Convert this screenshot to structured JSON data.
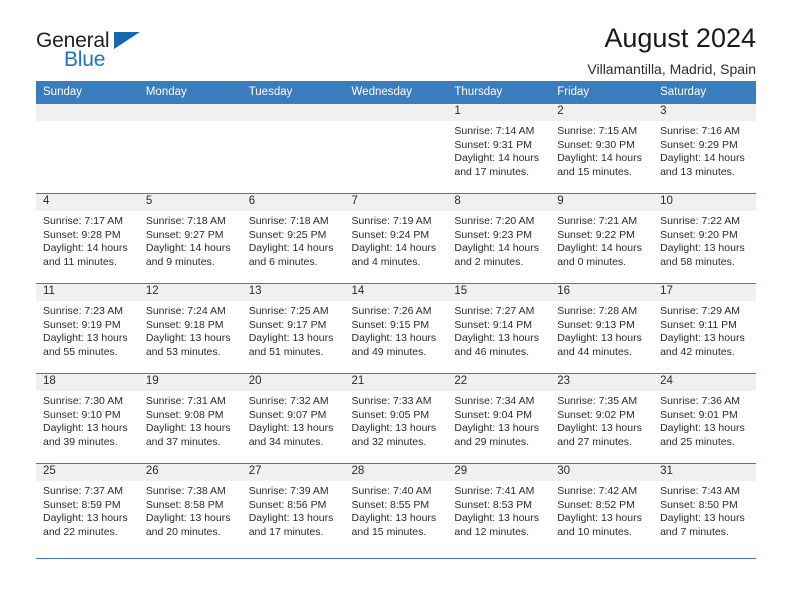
{
  "brand": {
    "name_part1": "General",
    "name_part2": "Blue",
    "flag_icon": "triangle-flag-icon"
  },
  "header": {
    "title": "August 2024",
    "subtitle": "Villamantilla, Madrid, Spain"
  },
  "colors": {
    "header_blue": "#3a7cbe",
    "brand_blue": "#1b76bc",
    "daynum_band": "#f0f0f0",
    "text": "#2b2b2b"
  },
  "weekdays": [
    "Sunday",
    "Monday",
    "Tuesday",
    "Wednesday",
    "Thursday",
    "Friday",
    "Saturday"
  ],
  "labels": {
    "sunrise_prefix": "Sunrise:",
    "sunset_prefix": "Sunset:",
    "daylight_prefix": "Daylight:"
  },
  "weeks": [
    [
      {
        "day": "",
        "lines": []
      },
      {
        "day": "",
        "lines": []
      },
      {
        "day": "",
        "lines": []
      },
      {
        "day": "",
        "lines": []
      },
      {
        "day": "1",
        "lines": [
          "Sunrise: 7:14 AM",
          "Sunset: 9:31 PM",
          "Daylight: 14 hours",
          "and 17 minutes."
        ]
      },
      {
        "day": "2",
        "lines": [
          "Sunrise: 7:15 AM",
          "Sunset: 9:30 PM",
          "Daylight: 14 hours",
          "and 15 minutes."
        ]
      },
      {
        "day": "3",
        "lines": [
          "Sunrise: 7:16 AM",
          "Sunset: 9:29 PM",
          "Daylight: 14 hours",
          "and 13 minutes."
        ]
      }
    ],
    [
      {
        "day": "4",
        "lines": [
          "Sunrise: 7:17 AM",
          "Sunset: 9:28 PM",
          "Daylight: 14 hours",
          "and 11 minutes."
        ]
      },
      {
        "day": "5",
        "lines": [
          "Sunrise: 7:18 AM",
          "Sunset: 9:27 PM",
          "Daylight: 14 hours",
          "and 9 minutes."
        ]
      },
      {
        "day": "6",
        "lines": [
          "Sunrise: 7:18 AM",
          "Sunset: 9:25 PM",
          "Daylight: 14 hours",
          "and 6 minutes."
        ]
      },
      {
        "day": "7",
        "lines": [
          "Sunrise: 7:19 AM",
          "Sunset: 9:24 PM",
          "Daylight: 14 hours",
          "and 4 minutes."
        ]
      },
      {
        "day": "8",
        "lines": [
          "Sunrise: 7:20 AM",
          "Sunset: 9:23 PM",
          "Daylight: 14 hours",
          "and 2 minutes."
        ]
      },
      {
        "day": "9",
        "lines": [
          "Sunrise: 7:21 AM",
          "Sunset: 9:22 PM",
          "Daylight: 14 hours",
          "and 0 minutes."
        ]
      },
      {
        "day": "10",
        "lines": [
          "Sunrise: 7:22 AM",
          "Sunset: 9:20 PM",
          "Daylight: 13 hours",
          "and 58 minutes."
        ]
      }
    ],
    [
      {
        "day": "11",
        "lines": [
          "Sunrise: 7:23 AM",
          "Sunset: 9:19 PM",
          "Daylight: 13 hours",
          "and 55 minutes."
        ]
      },
      {
        "day": "12",
        "lines": [
          "Sunrise: 7:24 AM",
          "Sunset: 9:18 PM",
          "Daylight: 13 hours",
          "and 53 minutes."
        ]
      },
      {
        "day": "13",
        "lines": [
          "Sunrise: 7:25 AM",
          "Sunset: 9:17 PM",
          "Daylight: 13 hours",
          "and 51 minutes."
        ]
      },
      {
        "day": "14",
        "lines": [
          "Sunrise: 7:26 AM",
          "Sunset: 9:15 PM",
          "Daylight: 13 hours",
          "and 49 minutes."
        ]
      },
      {
        "day": "15",
        "lines": [
          "Sunrise: 7:27 AM",
          "Sunset: 9:14 PM",
          "Daylight: 13 hours",
          "and 46 minutes."
        ]
      },
      {
        "day": "16",
        "lines": [
          "Sunrise: 7:28 AM",
          "Sunset: 9:13 PM",
          "Daylight: 13 hours",
          "and 44 minutes."
        ]
      },
      {
        "day": "17",
        "lines": [
          "Sunrise: 7:29 AM",
          "Sunset: 9:11 PM",
          "Daylight: 13 hours",
          "and 42 minutes."
        ]
      }
    ],
    [
      {
        "day": "18",
        "lines": [
          "Sunrise: 7:30 AM",
          "Sunset: 9:10 PM",
          "Daylight: 13 hours",
          "and 39 minutes."
        ]
      },
      {
        "day": "19",
        "lines": [
          "Sunrise: 7:31 AM",
          "Sunset: 9:08 PM",
          "Daylight: 13 hours",
          "and 37 minutes."
        ]
      },
      {
        "day": "20",
        "lines": [
          "Sunrise: 7:32 AM",
          "Sunset: 9:07 PM",
          "Daylight: 13 hours",
          "and 34 minutes."
        ]
      },
      {
        "day": "21",
        "lines": [
          "Sunrise: 7:33 AM",
          "Sunset: 9:05 PM",
          "Daylight: 13 hours",
          "and 32 minutes."
        ]
      },
      {
        "day": "22",
        "lines": [
          "Sunrise: 7:34 AM",
          "Sunset: 9:04 PM",
          "Daylight: 13 hours",
          "and 29 minutes."
        ]
      },
      {
        "day": "23",
        "lines": [
          "Sunrise: 7:35 AM",
          "Sunset: 9:02 PM",
          "Daylight: 13 hours",
          "and 27 minutes."
        ]
      },
      {
        "day": "24",
        "lines": [
          "Sunrise: 7:36 AM",
          "Sunset: 9:01 PM",
          "Daylight: 13 hours",
          "and 25 minutes."
        ]
      }
    ],
    [
      {
        "day": "25",
        "lines": [
          "Sunrise: 7:37 AM",
          "Sunset: 8:59 PM",
          "Daylight: 13 hours",
          "and 22 minutes."
        ]
      },
      {
        "day": "26",
        "lines": [
          "Sunrise: 7:38 AM",
          "Sunset: 8:58 PM",
          "Daylight: 13 hours",
          "and 20 minutes."
        ]
      },
      {
        "day": "27",
        "lines": [
          "Sunrise: 7:39 AM",
          "Sunset: 8:56 PM",
          "Daylight: 13 hours",
          "and 17 minutes."
        ]
      },
      {
        "day": "28",
        "lines": [
          "Sunrise: 7:40 AM",
          "Sunset: 8:55 PM",
          "Daylight: 13 hours",
          "and 15 minutes."
        ]
      },
      {
        "day": "29",
        "lines": [
          "Sunrise: 7:41 AM",
          "Sunset: 8:53 PM",
          "Daylight: 13 hours",
          "and 12 minutes."
        ]
      },
      {
        "day": "30",
        "lines": [
          "Sunrise: 7:42 AM",
          "Sunset: 8:52 PM",
          "Daylight: 13 hours",
          "and 10 minutes."
        ]
      },
      {
        "day": "31",
        "lines": [
          "Sunrise: 7:43 AM",
          "Sunset: 8:50 PM",
          "Daylight: 13 hours",
          "and 7 minutes."
        ]
      }
    ]
  ]
}
